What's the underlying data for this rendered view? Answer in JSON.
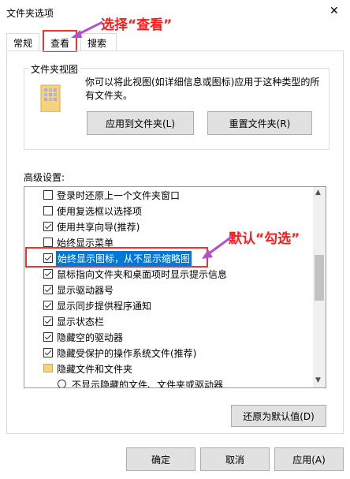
{
  "window": {
    "title": "文件夹选项",
    "close_glyph": "✕"
  },
  "tabs": [
    {
      "label": "常规"
    },
    {
      "label": "查看"
    },
    {
      "label": "搜索"
    }
  ],
  "folder_views": {
    "group_title": "文件夹视图",
    "description": "你可以将此视图(如详细信息或图标)应用于这种类型的所有文件夹。",
    "apply_button": "应用到文件夹(L)",
    "reset_button": "重置文件夹(R)"
  },
  "advanced": {
    "label": "高级设置:",
    "items": [
      {
        "label": "登录时还原上一个文件夹窗口",
        "checked": false
      },
      {
        "label": "使用复选框以选择项",
        "checked": false
      },
      {
        "label": "使用共享向导(推荐)",
        "checked": true
      },
      {
        "label": "始终显示菜单",
        "checked": false
      },
      {
        "label": "始终显示图标，从不显示缩略图",
        "checked": true,
        "selected": true
      },
      {
        "label": "鼠标指向文件夹和桌面项时显示提示信息",
        "checked": true
      },
      {
        "label": "显示驱动器号",
        "checked": true
      },
      {
        "label": "显示同步提供程序通知",
        "checked": true
      },
      {
        "label": "显示状态栏",
        "checked": true
      },
      {
        "label": "隐藏空的驱动器",
        "checked": true
      },
      {
        "label": "隐藏受保护的操作系统文件(推荐)",
        "checked": true
      }
    ],
    "folder_item": "隐藏文件和文件夹",
    "radio_item": "不显示隐藏的文件、文件夹或驱动器",
    "restore_button": "还原为默认值(D)"
  },
  "footer": {
    "ok": "确定",
    "cancel": "取消",
    "apply": "应用(A)"
  },
  "annotations": {
    "select_view": "选择“查看”",
    "default_check": "默认“勾选”"
  },
  "colors": {
    "highlight": "#0078d7",
    "annotation_red": "#ff1a1a",
    "arrow_purple": "#b44fd0"
  }
}
